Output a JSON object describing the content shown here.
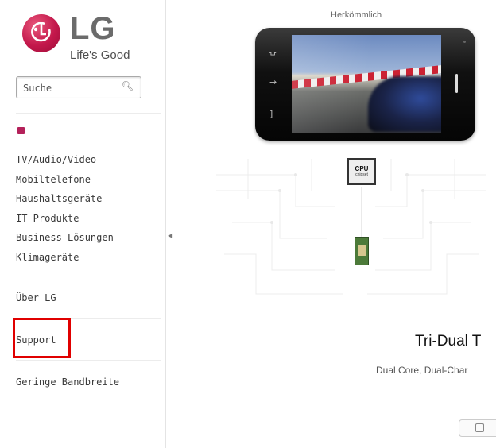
{
  "brand": {
    "logo_text": "LG",
    "tagline": "Life's Good",
    "accent_color": "#b4215a"
  },
  "search": {
    "placeholder": "Suche",
    "icon": "search-icon"
  },
  "nav": {
    "categories": [
      "TV/Audio/Video",
      "Mobiltelefone",
      "Haushaltsgeräte",
      "IT Produkte",
      "Business Lösungen",
      "Klimageräte"
    ],
    "about": "Über LG",
    "support": "Support",
    "low_bandwidth": "Geringe Bandbreite"
  },
  "main": {
    "phone_label": "Herkömmlich",
    "cpu_label": "CPU",
    "cpu_sublabel": "chipset",
    "headline": "Tri-Dual T",
    "subline": "Dual Core, Dual-Char",
    "highlight_color": "#e00000"
  }
}
